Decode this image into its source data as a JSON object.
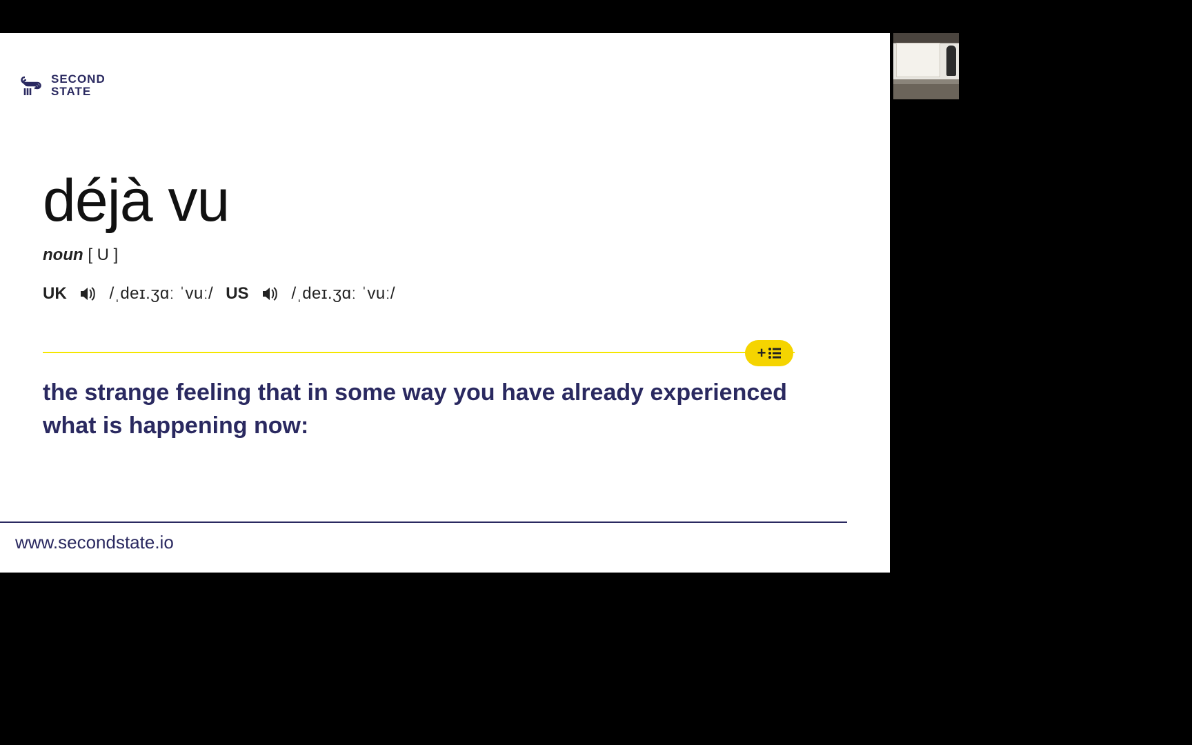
{
  "brand": {
    "name_line1": "SECOND",
    "name_line2": "STATE",
    "accent_color": "#2a2960"
  },
  "entry": {
    "headword": "déjà vu",
    "part_of_speech": "noun",
    "countability": "[ U ]",
    "pronunciations": {
      "uk": {
        "label": "UK",
        "ipa": "/ˌdeɪ.ʒɑː ˈvuː/"
      },
      "us": {
        "label": "US",
        "ipa": "/ˌdeɪ.ʒɑː ˈvuː/"
      }
    },
    "definition": "the strange feeling that in some way you have already experienced what is happening now:"
  },
  "add_button": {
    "plus": "+"
  },
  "footer": {
    "url": "www.secondstate.io"
  },
  "colors": {
    "divider": "#f5e600",
    "button": "#f5d400",
    "text_primary": "#2a2960"
  }
}
